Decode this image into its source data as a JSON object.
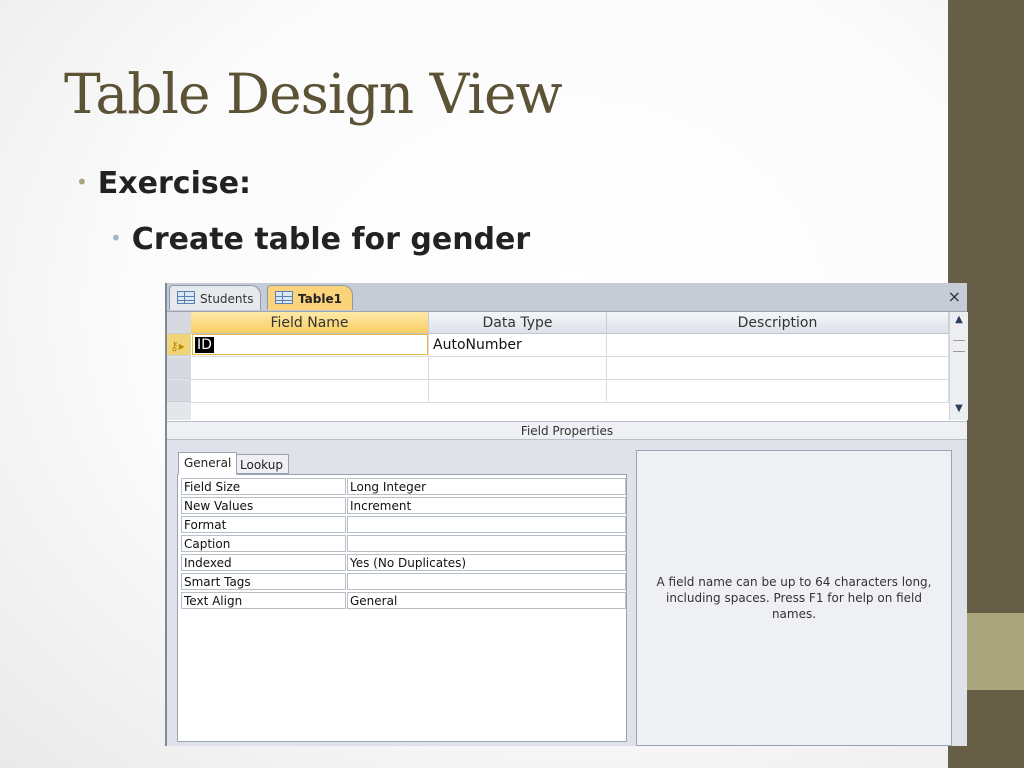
{
  "slide": {
    "title": "Table Design View",
    "bullets": [
      "Exercise:",
      "Create table for gender"
    ]
  },
  "access": {
    "tabs": [
      {
        "label": "Students",
        "icon": "table-icon",
        "active": false
      },
      {
        "label": "Table1",
        "icon": "table-icon",
        "active": true
      }
    ],
    "grid": {
      "headers": [
        "Field Name",
        "Data Type",
        "Description"
      ],
      "rows": [
        {
          "field_name": "ID",
          "data_type": "AutoNumber",
          "description": "",
          "primary_key": true
        },
        {
          "field_name": "",
          "data_type": "",
          "description": ""
        },
        {
          "field_name": "",
          "data_type": "",
          "description": ""
        }
      ]
    },
    "field_properties_label": "Field Properties",
    "property_tabs": [
      "General",
      "Lookup"
    ],
    "properties": [
      {
        "label": "Field Size",
        "value": "Long Integer"
      },
      {
        "label": "New Values",
        "value": "Increment"
      },
      {
        "label": "Format",
        "value": ""
      },
      {
        "label": "Caption",
        "value": ""
      },
      {
        "label": "Indexed",
        "value": "Yes (No Duplicates)"
      },
      {
        "label": "Smart Tags",
        "value": ""
      },
      {
        "label": "Text Align",
        "value": "General"
      }
    ],
    "help_text": "A field name can be up to 64 characters long, including spaces. Press F1 for help on field names."
  },
  "colors": {
    "accent": "#675e47",
    "title": "#5c5236",
    "active_tab": "#fad37a"
  }
}
